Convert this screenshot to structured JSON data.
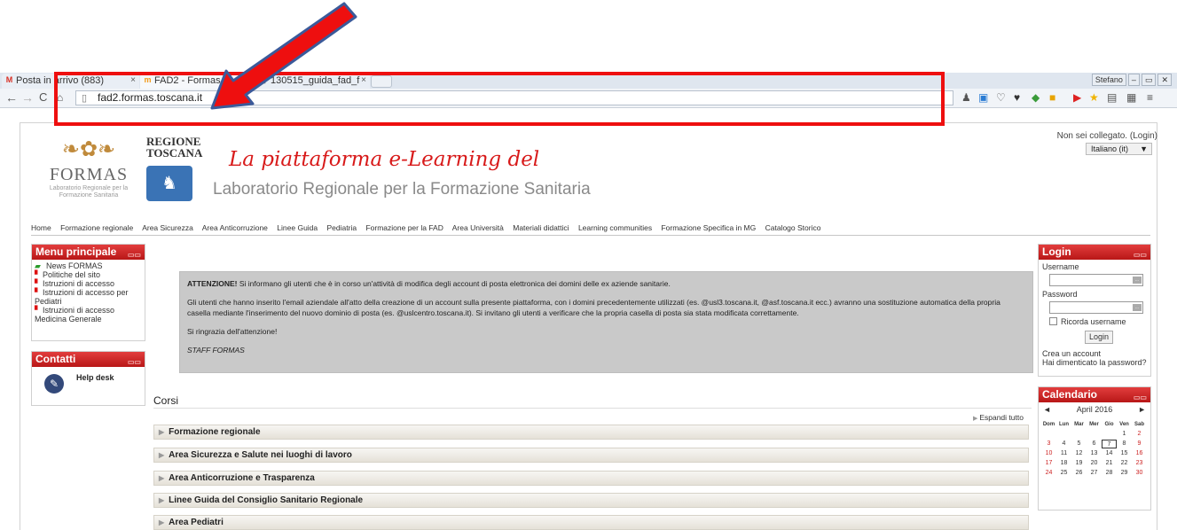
{
  "browser": {
    "tabs": [
      {
        "label": "Posta in arrivo (883)",
        "icon": "gmail-icon"
      },
      {
        "label": "FAD2 - Formas T",
        "icon": "moodle-icon"
      },
      {
        "label": "130515_guida_fad_f",
        "icon": "document-icon"
      }
    ],
    "tab_close": "×",
    "window_user": "Stefano",
    "url": "fad2.formas.toscana.it"
  },
  "header": {
    "formas_logo": {
      "name": "FORMAS",
      "subtitle": "Laboratorio Regionale per la Formazione Sanitaria"
    },
    "region_logo": {
      "name": "REGIONE TOSCANA"
    },
    "headline": "La piattaforma e-Learning del",
    "subheadline": "Laboratorio Regionale per la Formazione Sanitaria",
    "login_status": "Non sei collegato. (Login)",
    "language": "Italiano (it)"
  },
  "nav": [
    "Home",
    "Formazione regionale",
    "Area Sicurezza",
    "Area Anticorruzione",
    "Linee Guida",
    "Pediatria",
    "Formazione per la FAD",
    "Area Università",
    "Materiali didattici",
    "Learning communities",
    "Formazione Specifica in MG",
    "Catalogo Storico"
  ],
  "menu": {
    "title": "Menu principale",
    "items": [
      "News FORMAS",
      "Politiche del sito",
      "Istruzioni di accesso",
      "Istruzioni di accesso per Pediatri",
      "Istruzioni di accesso Medicina Generale"
    ]
  },
  "contatti": {
    "title": "Contatti",
    "helpdesk": "Help desk"
  },
  "notice": {
    "strong": "ATTENZIONE!",
    "line1": " Si informano gli utenti che è in corso un'attività di modifica degli account di posta elettronica dei domini delle ex aziende sanitarie.",
    "line2": "Gli utenti che hanno inserito l'email aziendale all'atto della creazione di un account sulla presente piattaforma, con i domini precedentemente utilizzati (es. @usl3.toscana.it, @asf.toscana.it ecc.) avranno una sostituzione automatica della propria casella mediante l'inserimento del nuovo dominio di posta (es. @uslcentro.toscana.it). Si invitano gli utenti a verificare che la propria casella di posta sia stata modificata correttamente.",
    "line3": "Si ringrazia dell'attenzione!",
    "staff": "STAFF FORMAS"
  },
  "courses": {
    "title": "Corsi",
    "expand_all": "Espandi tutto",
    "categories": [
      "Formazione regionale",
      "Area Sicurezza e Salute nei luoghi di lavoro",
      "Area Anticorruzione e Trasparenza",
      "Linee Guida del Consiglio Sanitario Regionale",
      "Area Pediatri"
    ]
  },
  "login": {
    "title": "Login",
    "username_label": "Username",
    "password_label": "Password",
    "remember": "Ricorda username",
    "button": "Login",
    "create_account": "Crea un account",
    "forgot": "Hai dimenticato la password?"
  },
  "calendar": {
    "title": "Calendario",
    "month": "April 2016",
    "prev": "◄",
    "next": "►",
    "weekdays": [
      "Dom",
      "Lun",
      "Mar",
      "Mer",
      "Gio",
      "Ven",
      "Sab"
    ],
    "weeks": [
      [
        "",
        "",
        "",
        "",
        "",
        "1",
        "2"
      ],
      [
        "3",
        "4",
        "5",
        "6",
        "7",
        "8",
        "9"
      ],
      [
        "10",
        "11",
        "12",
        "13",
        "14",
        "15",
        "16"
      ],
      [
        "17",
        "18",
        "19",
        "20",
        "21",
        "22",
        "23"
      ],
      [
        "24",
        "25",
        "26",
        "27",
        "28",
        "29",
        "30"
      ]
    ],
    "today": "7"
  },
  "colors": {
    "annotation": "#ee0f0f",
    "block_header": "#c42020",
    "headline": "#d81a1a"
  }
}
